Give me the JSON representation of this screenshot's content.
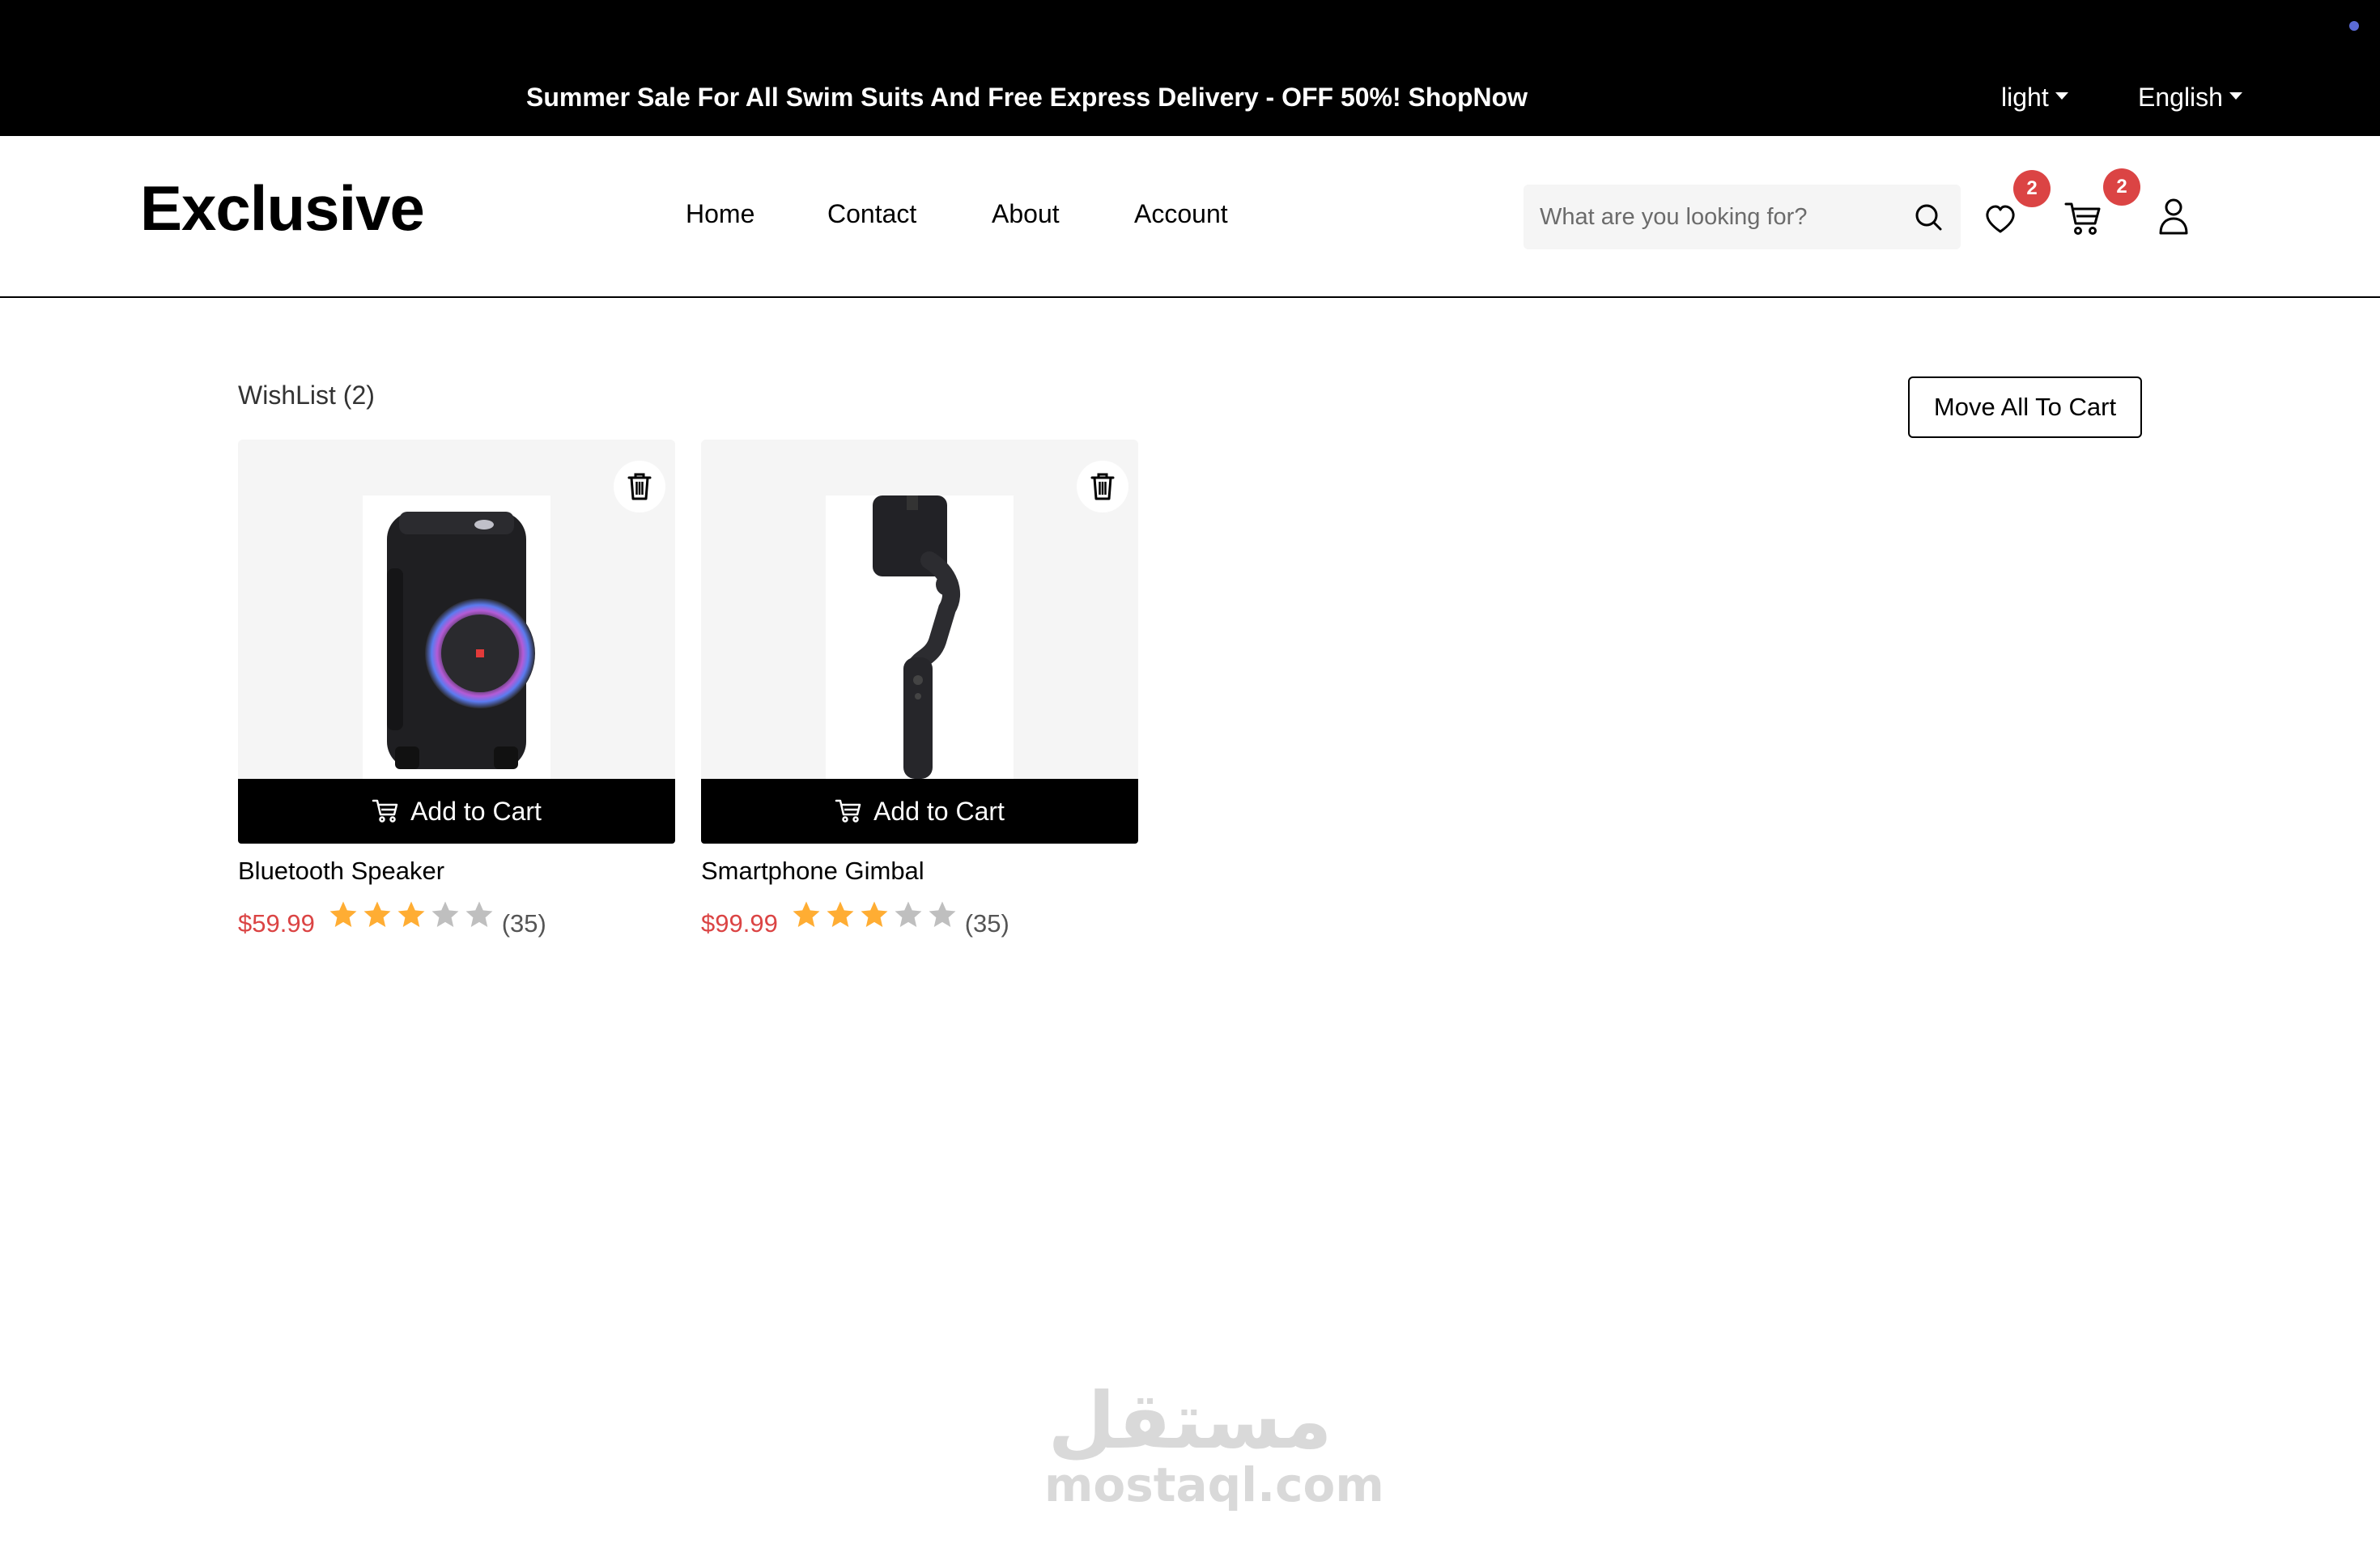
{
  "topbar": {
    "promo": "Summer Sale For All Swim Suits And Free Express Delivery - OFF 50%! ShopNow",
    "theme_selector": "light",
    "language_selector": "English"
  },
  "header": {
    "logo": "Exclusive",
    "nav": [
      "Home",
      "Contact",
      "About",
      "Account"
    ],
    "search_placeholder": "What are you looking for?",
    "wishlist_count": "2",
    "cart_count": "2"
  },
  "wishlist": {
    "title": "WishList (2)",
    "move_all_label": "Move All To Cart",
    "items": [
      {
        "name": "Bluetooth Speaker",
        "price": "$59.99",
        "rating": 3,
        "rating_max": 5,
        "reviews": "(35)",
        "add_label": "Add to Cart"
      },
      {
        "name": "Smartphone Gimbal",
        "price": "$99.99",
        "rating": 3,
        "rating_max": 5,
        "reviews": "(35)",
        "add_label": "Add to Cart"
      }
    ]
  },
  "watermark": {
    "arabic": "مستقل",
    "latin": "mostaql.com"
  },
  "colors": {
    "topbar_bg": "#000000",
    "accent_red": "#db4444",
    "star_filled": "#ffad33",
    "star_empty": "#bfbfbf",
    "card_bg": "#f5f5f5"
  }
}
